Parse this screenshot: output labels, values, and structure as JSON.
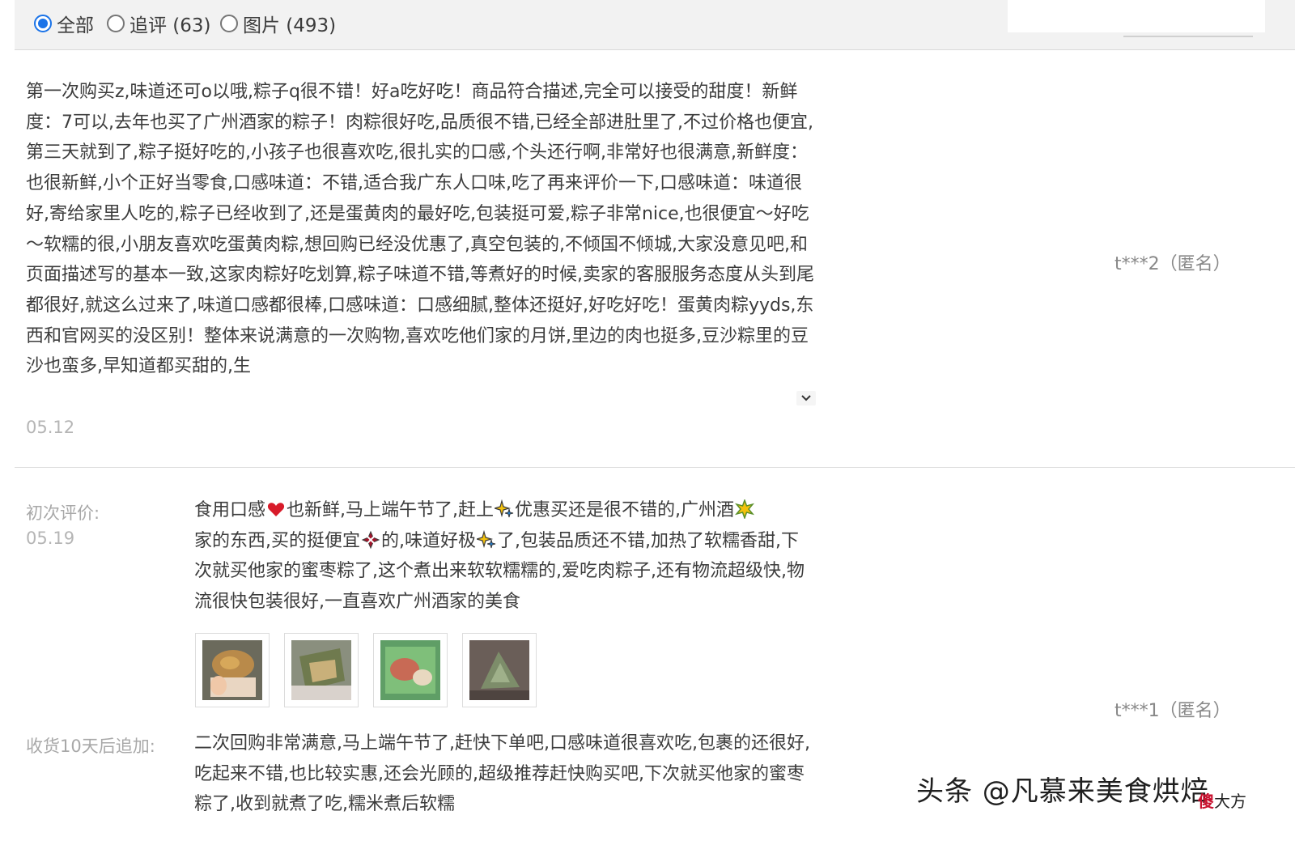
{
  "filter": {
    "options": [
      {
        "label": "全部",
        "checked": true
      },
      {
        "label": "追评 (63)",
        "checked": false
      },
      {
        "label": "图片 (493)",
        "checked": false
      }
    ]
  },
  "review1": {
    "text": "第一次购买z,味道还可o以哦,粽子q很不错！好a吃好吃！商品符合描述,完全可以接受的甜度！新鲜度：7可以,去年也买了广州酒家的粽子！肉粽很好吃,品质很不错,已经全部进肚里了,不过价格也便宜,第三天就到了,粽子挺好吃的,小孩子也很喜欢吃,很扎实的口感,个头还行啊,非常好也很满意,新鲜度：也很新鲜,小个正好当零食,口感味道：不错,适合我广东人口味,吃了再来评价一下,口感味道：味道很好,寄给家里人吃的,粽子已经收到了,还是蛋黄肉的最好吃,包装挺可爱,粽子非常nice,也很便宜～好吃～软糯的很,小朋友喜欢吃蛋黄肉粽,想回购已经没优惠了,真空包装的,不倾国不倾城,大家没意见吧,和页面描述写的基本一致,这家肉粽好吃划算,粽子味道不错,等煮好的时候,卖家的客服服务态度从头到尾都很好,就这么过来了,味道口感都很棒,口感味道：口感细腻,整体还挺好,好吃好吃！蛋黄肉粽yyds,东西和官网买的没区别！整体来说满意的一次购物,喜欢吃他们家的月饼,里边的肉也挺多,豆沙粽里的豆沙也蛮多,早知道都买甜的,生",
    "date": "05.12",
    "user": "t***2（匿名）"
  },
  "review2": {
    "initial_label": "初次评价:",
    "initial_date": "05.19",
    "text_parts": [
      "食用口感",
      "也新鲜,马上端午节了,赶上",
      "优惠买还是很不错的,广州酒",
      "家的东西,买的挺便宜",
      "的,味道好极",
      "了,包装品质还不错,加热了软糯香甜,下次就买他家的蜜枣粽了,这个煮出来软软糯糯的,爱吃肉粽子,还有物流超级快,物流很快包装很好,一直喜欢广州酒家的美食"
    ],
    "emoji_icons": [
      "heart-emoji-icon",
      "sparkle-emoji-icon",
      "star-burst-emoji-icon",
      "anger-emoji-icon",
      "sparkle-emoji-icon"
    ],
    "photo_count": 4,
    "user": "t***1（匿名）",
    "followup_label": "收货10天后追加:",
    "followup_text": "二次回购非常满意,马上端午节了,赶快下单吧,口感味道很喜欢吃,包裹的还很好,吃起来不错,也比较实惠,还会光顾的,超级推荐赶快购买吧,下次就买他家的蜜枣粽了,收到就煮了吃,糯米煮后软糯"
  },
  "watermark": {
    "text": "头条 @凡慕来美食烘焙",
    "badge_red": "傻",
    "badge_dark": "大方"
  },
  "colors": {
    "accent": "#1a73e8",
    "text": "#3c3c3c",
    "muted": "#b5b5b5",
    "bar": "#f2f2f2"
  }
}
